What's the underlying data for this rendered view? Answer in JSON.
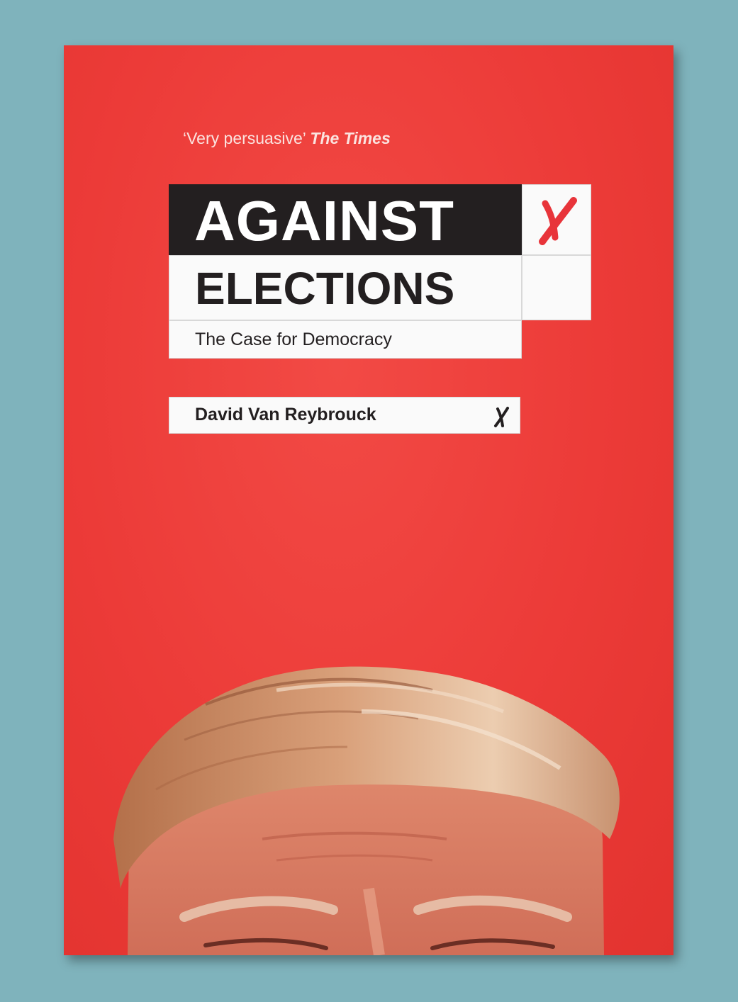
{
  "cover": {
    "quote": "‘Very persuasive’",
    "quote_source": "The Times",
    "title_line1": "AGAINST",
    "title_line2": "ELECTIONS",
    "subtitle": "The Case for Democracy",
    "author": "David Van Reybrouck"
  },
  "colors": {
    "background": "#7fb3bc",
    "cover_red": "#ec3b38",
    "title_black": "#231f20",
    "box_white": "#fafafa",
    "mark_red": "#e8343a"
  },
  "icons": {
    "ballot_mark_large": "red-x-icon",
    "ballot_mark_small": "black-x-icon"
  }
}
